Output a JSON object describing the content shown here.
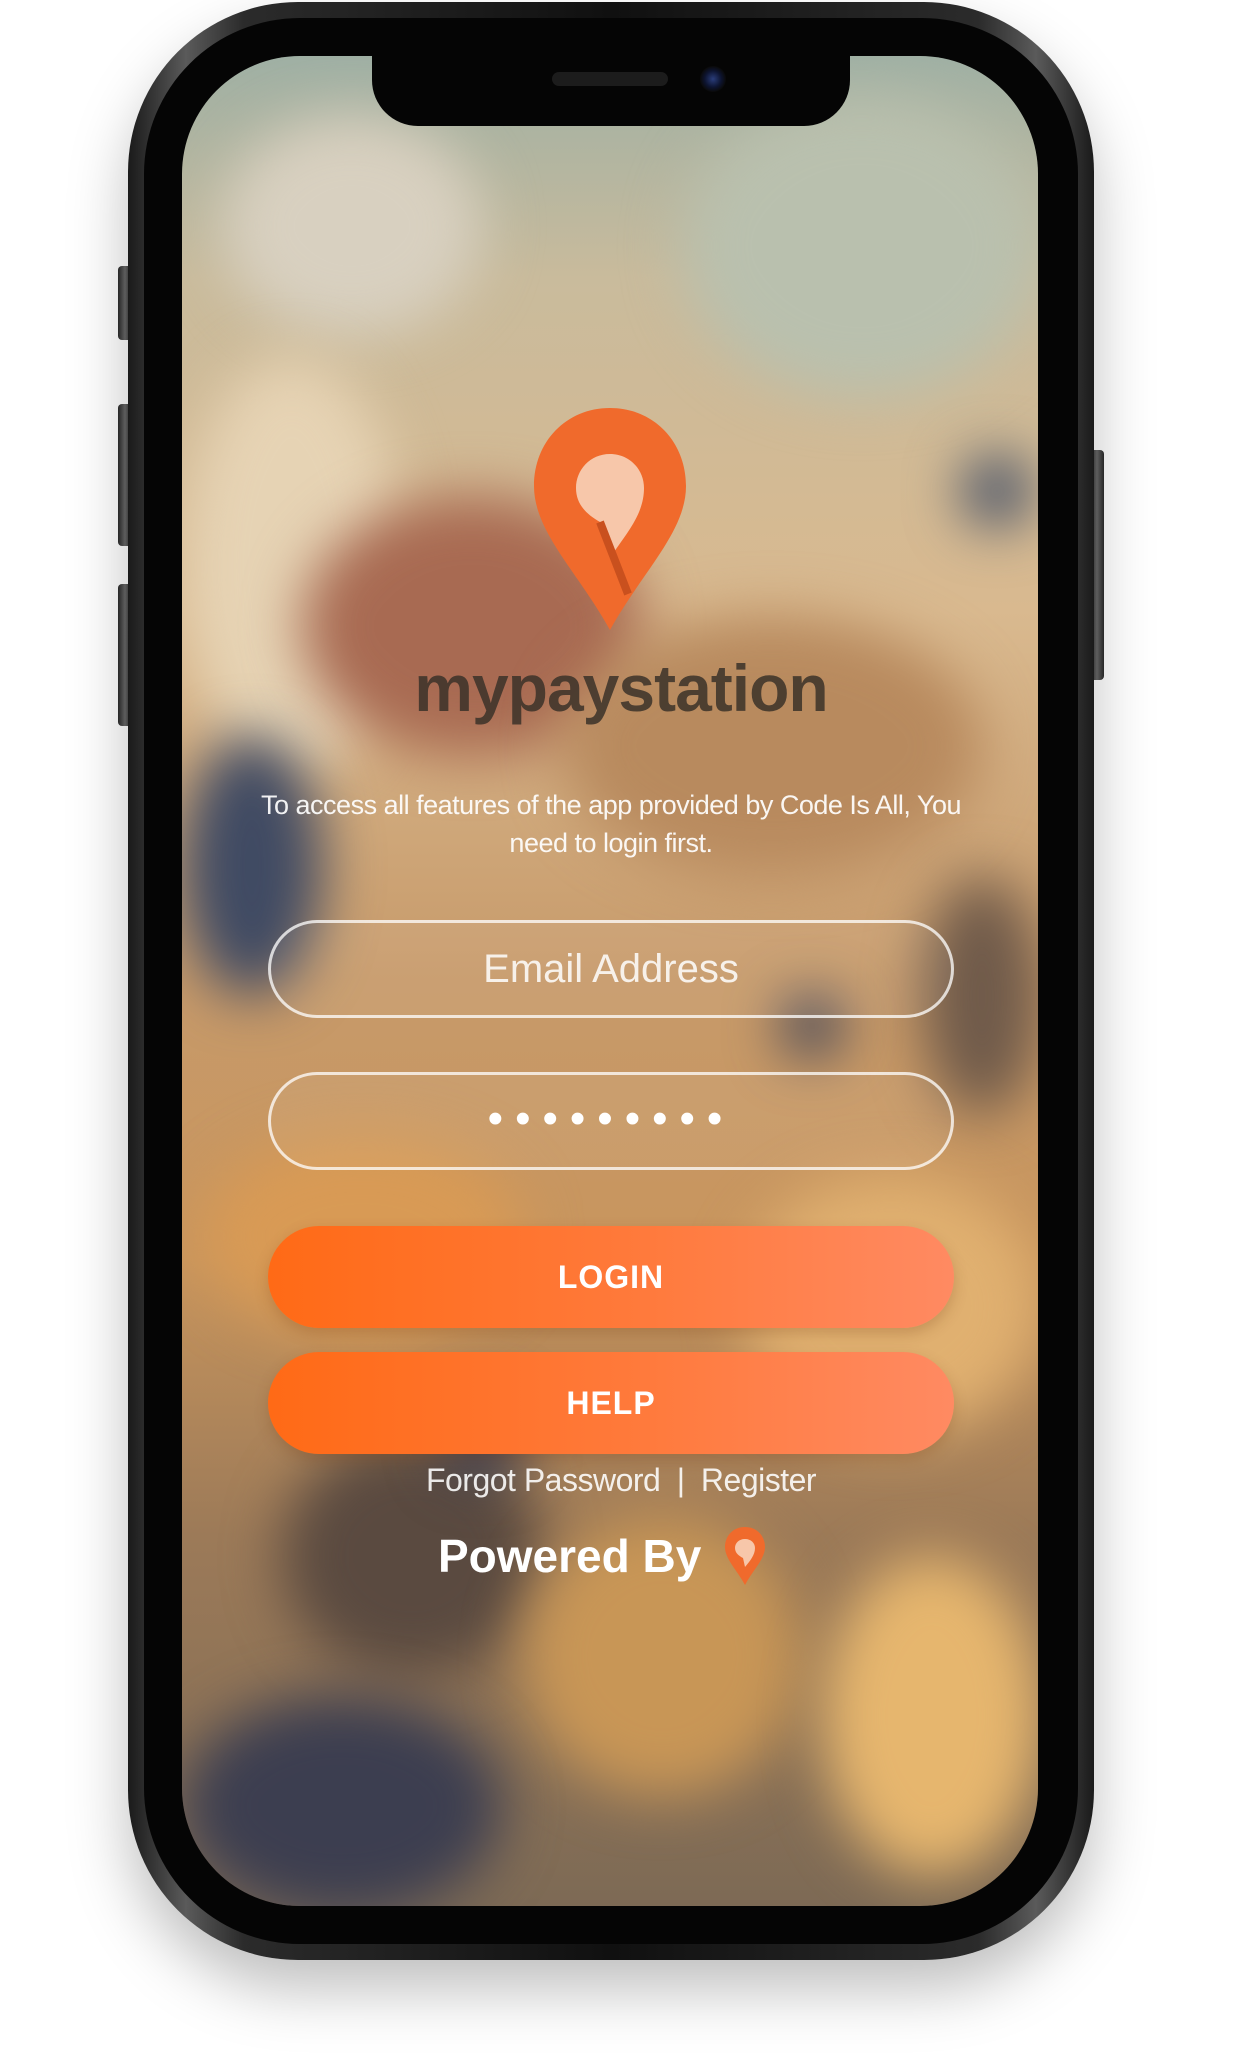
{
  "app": {
    "brand_name": "mypaystation",
    "tagline": "To access all features of the app provided by Code Is All, You need to login first."
  },
  "form": {
    "email_placeholder": "Email Address",
    "password_value": "•••••••••"
  },
  "buttons": {
    "login_label": "LOGIN",
    "help_label": "HELP"
  },
  "links": {
    "forgot_password": "Forgot Password",
    "separator": "|",
    "register": "Register"
  },
  "footer": {
    "powered_by": "Powered By"
  },
  "colors": {
    "accent": "#ff6a16",
    "brand_text": "#3b3229"
  },
  "icons": {
    "logo": "location-pin-icon",
    "mini_logo": "location-pin-icon"
  }
}
